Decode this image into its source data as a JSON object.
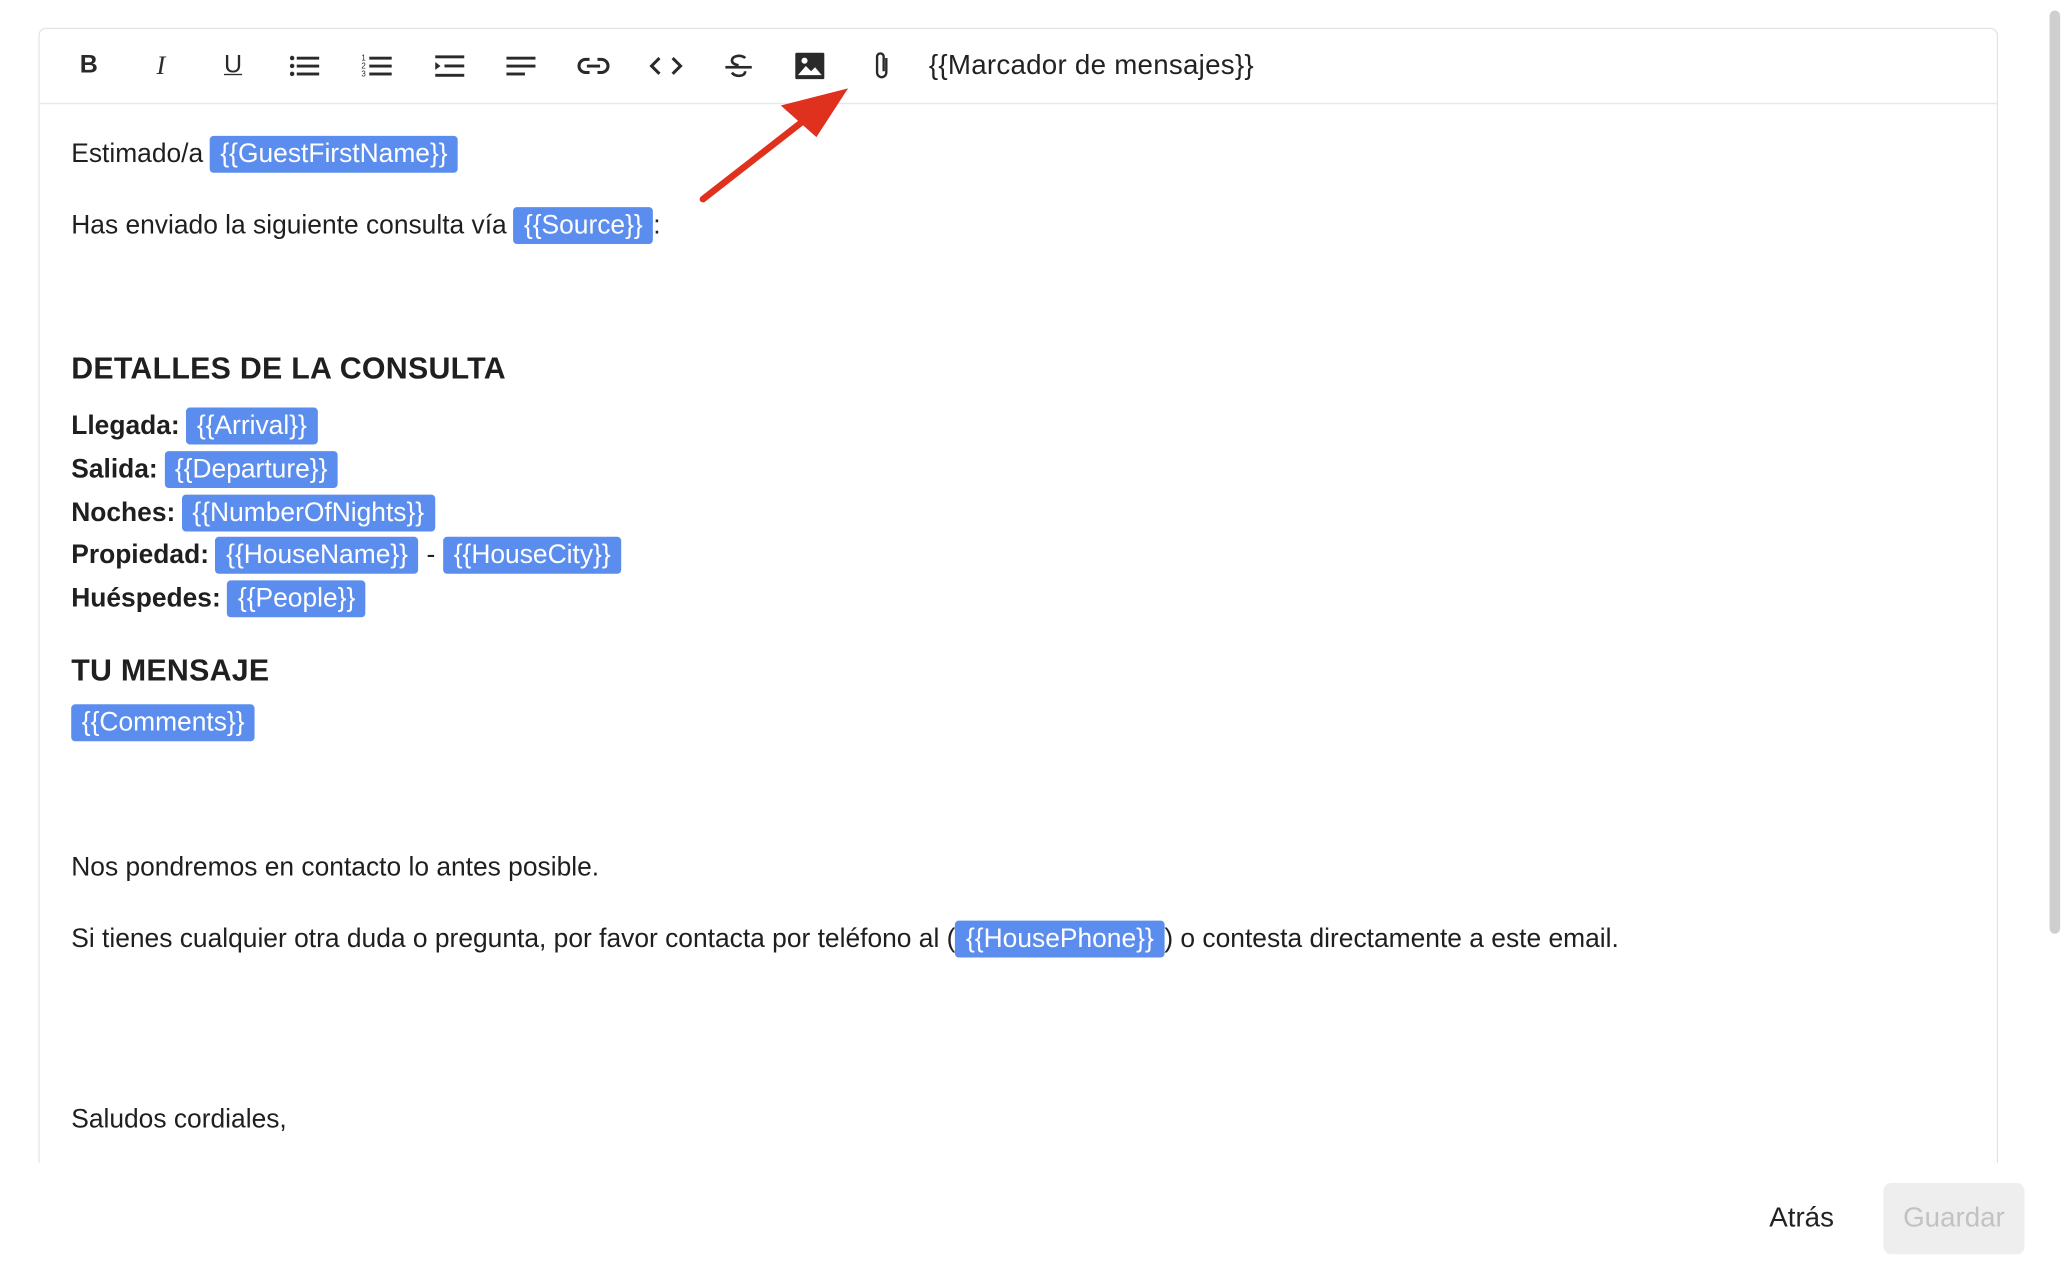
{
  "toolbar": {
    "bold_label": "B",
    "italic_label": "I",
    "underline_label": "U",
    "icons": [
      "bullet-list-icon",
      "numbered-list-icon",
      "indent-icon",
      "align-left-icon",
      "link-icon",
      "code-icon",
      "strikethrough-icon",
      "image-icon",
      "paperclip-icon"
    ],
    "placeholder_menu": "{{Marcador de mensajes}}"
  },
  "body": {
    "greeting_text": "Estimado/a",
    "greeting_tag": "{{GuestFirstName}}",
    "source_text": "Has enviado la siguiente consulta vía",
    "source_tag": "{{Source}}",
    "source_after": ":",
    "details_heading": "DETALLES DE LA CONSULTA",
    "details": [
      {
        "label": "Llegada:",
        "tag": "{{Arrival}}"
      },
      {
        "label": "Salida:",
        "tag": "{{Departure}}"
      },
      {
        "label": "Noches:",
        "tag": "{{NumberOfNights}}"
      },
      {
        "label": "Propiedad:",
        "tag": "{{HouseName}}",
        "separator": "-",
        "tag2": "{{HouseCity}}"
      },
      {
        "label": "Huéspedes:",
        "tag": "{{People}}"
      }
    ],
    "message_heading": "TU MENSAJE",
    "message_tag": "{{Comments}}",
    "contact_soon": "Nos pondremos en contacto lo antes posible.",
    "phone_before": "Si tienes cualquier otra duda o pregunta, por favor contacta por teléfono al (",
    "phone_tag": "{{HousePhone}}",
    "phone_after": ") o contesta directamente a este email.",
    "closing": "Saludos cordiales,"
  },
  "footer": {
    "back_label": "Atrás",
    "save_label": "Guardar"
  },
  "colors": {
    "tag_bg": "#5b8def",
    "annotation_arrow": "#e0301e",
    "save_disabled_bg": "#eeeeee"
  }
}
